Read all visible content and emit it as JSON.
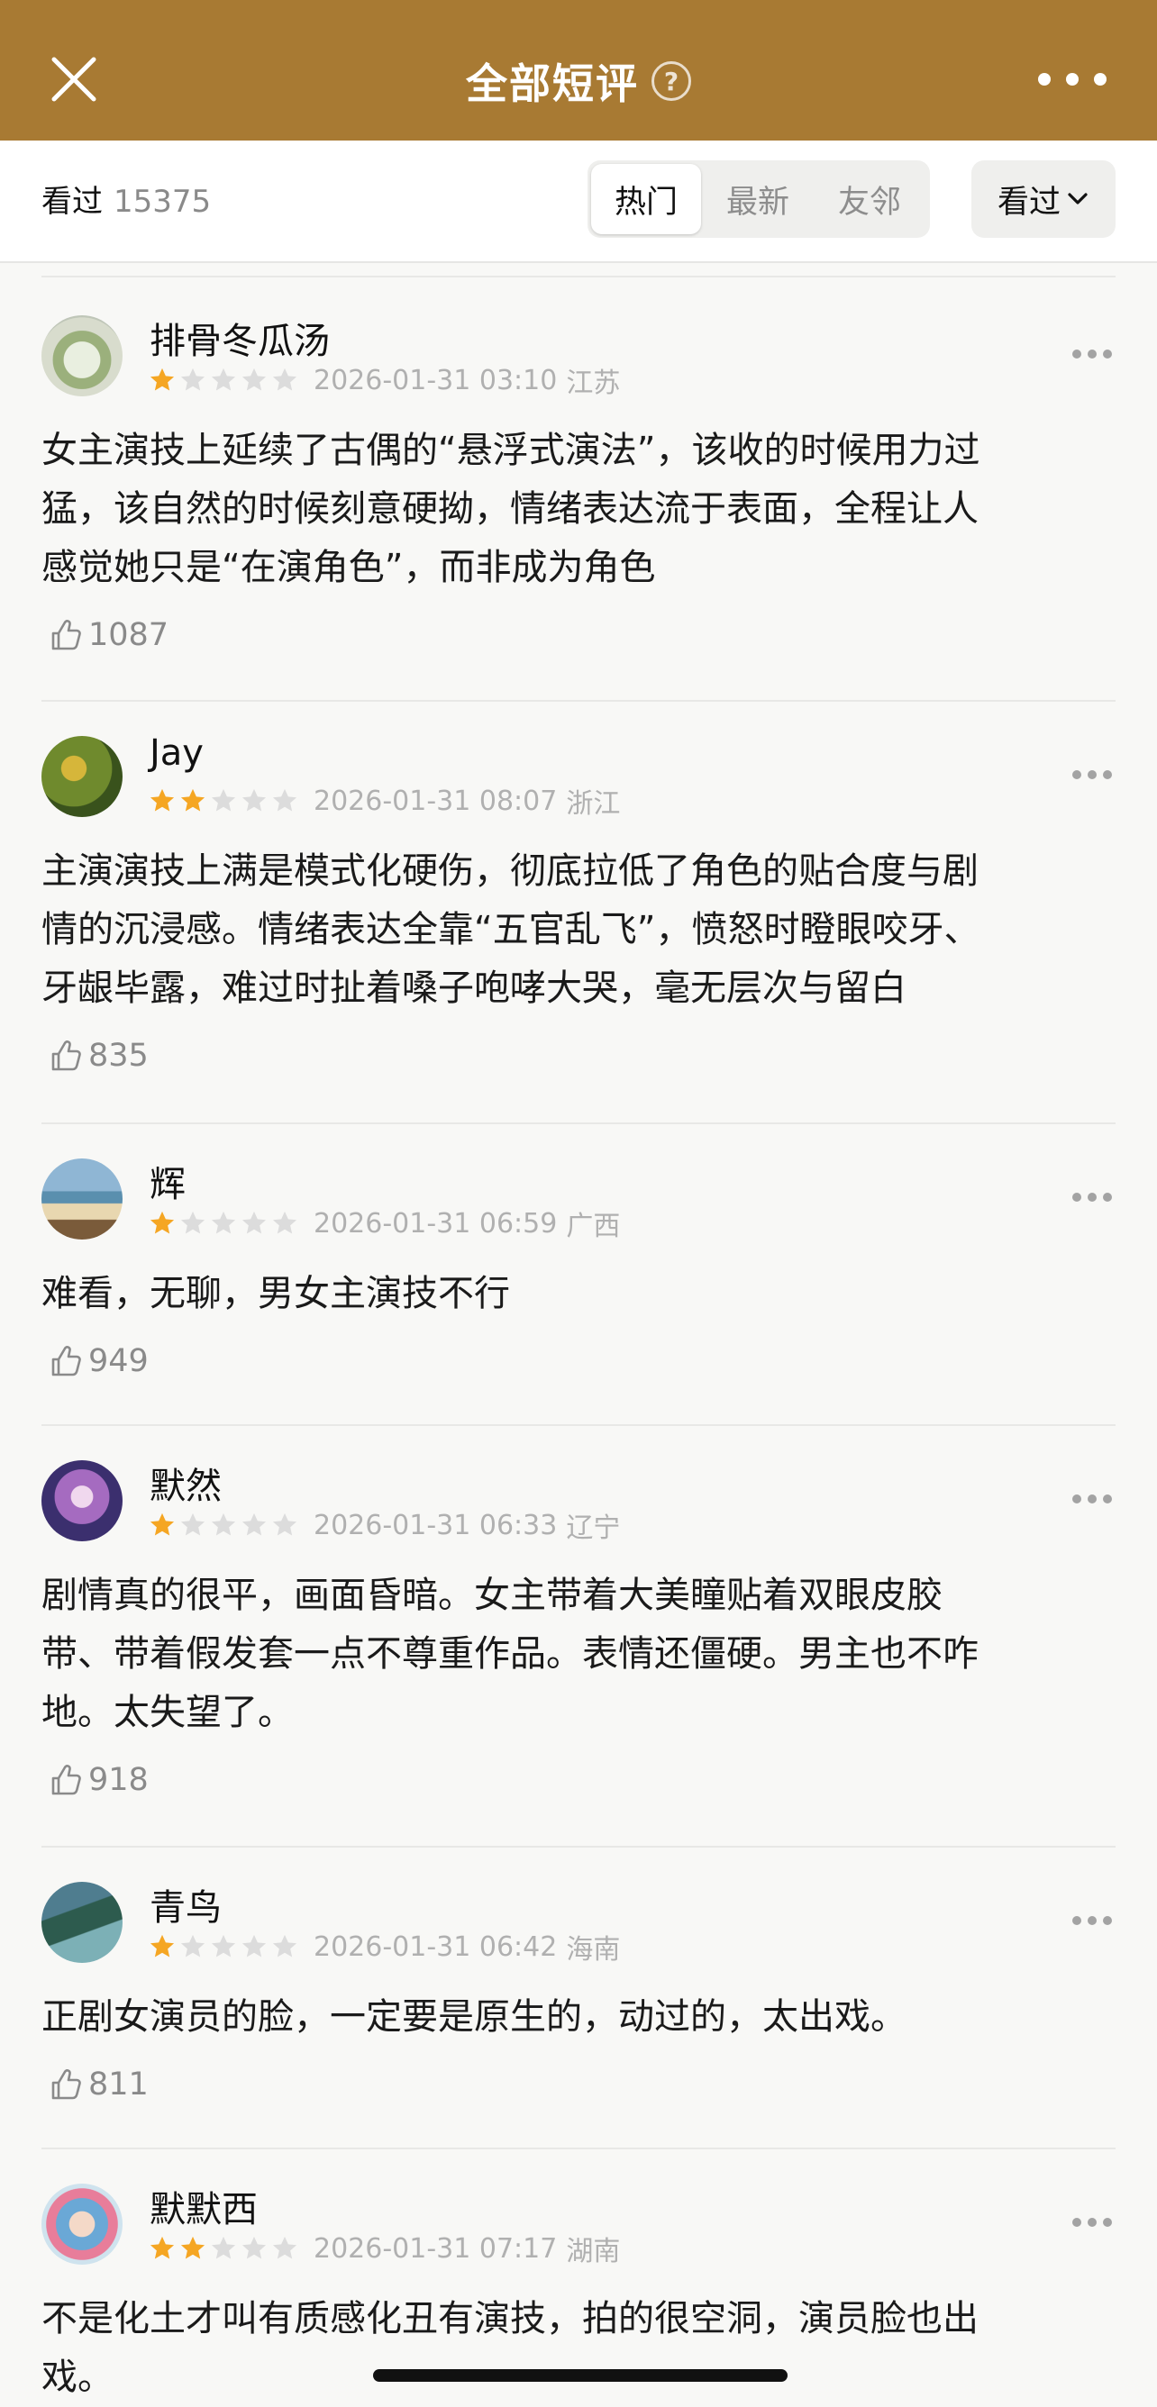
{
  "header": {
    "title": "全部短评",
    "help_icon": "question-circle-icon",
    "close_icon": "close-icon",
    "more_icon": "more-horizontal-icon",
    "background_color": "#a87a33"
  },
  "subheader": {
    "watched_label": "看过",
    "watched_count": "15375",
    "tabs": [
      {
        "label": "热门",
        "active": true
      },
      {
        "label": "最新",
        "active": false
      },
      {
        "label": "友邻",
        "active": false
      }
    ],
    "filter": {
      "label": "看过",
      "icon": "chevron-down-icon"
    }
  },
  "reviews": [
    {
      "username": "排骨冬瓜汤",
      "rating": 1,
      "date": "2026-01-31 03:10",
      "location": "江苏",
      "lines": [
        "女主演技上延续了古偶的“悬浮式演法”，该收的时候用力过",
        "猛，该自然的时候刻意硬拗，情绪表达流于表面，全程让人",
        "感觉她只是“在演角色”，而非成为角色"
      ],
      "likes": "1087"
    },
    {
      "username": "Jay",
      "rating": 2,
      "date": "2026-01-31 08:07",
      "location": "浙江",
      "lines": [
        "主演演技上满是模式化硬伤，彻底拉低了角色的贴合度与剧",
        "情的沉浸感。情绪表达全靠“五官乱飞”，愤怒时瞪眼咬牙、",
        "牙龈毕露，难过时扯着嗓子咆哮大哭，毫无层次与留白"
      ],
      "likes": "835"
    },
    {
      "username": "辉",
      "rating": 1,
      "date": "2026-01-31 06:59",
      "location": "广西",
      "lines": [
        "难看，无聊，男女主演技不行"
      ],
      "likes": "949"
    },
    {
      "username": "默然",
      "rating": 1,
      "date": "2026-01-31 06:33",
      "location": "辽宁",
      "lines": [
        "剧情真的很平，画面昏暗。女主带着大美瞳贴着双眼皮胶",
        "带、带着假发套一点不尊重作品。表情还僵硬。男主也不咋",
        "地。太失望了。"
      ],
      "likes": "918"
    },
    {
      "username": "青鸟",
      "rating": 1,
      "date": "2026-01-31 06:42",
      "location": "海南",
      "lines": [
        "正剧女演员的脸，一定要是原生的，动过的，太出戏。"
      ],
      "likes": "811"
    },
    {
      "username": "默默西",
      "rating": 2,
      "date": "2026-01-31 07:17",
      "location": "湖南",
      "lines": [
        "不是化土才叫有质感化丑有演技，拍的很空洞，演员脸也出",
        "戏。"
      ],
      "likes": ""
    }
  ],
  "colors": {
    "star_filled": "#f5a623",
    "star_empty": "#dcdcdc",
    "muted_text": "#8a8a8a"
  }
}
